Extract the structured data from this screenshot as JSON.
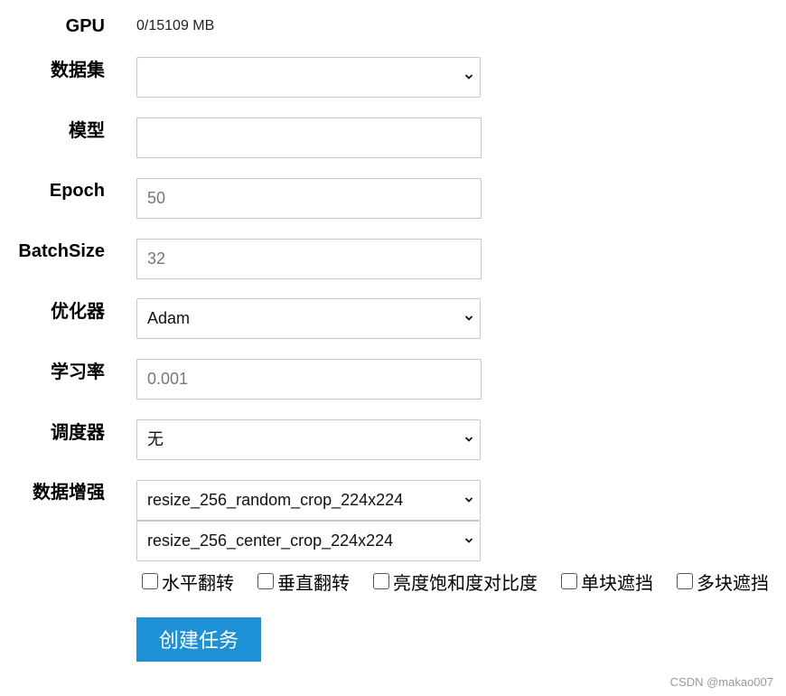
{
  "gpu": {
    "label": "GPU",
    "value": "0/15109 MB"
  },
  "dataset": {
    "label": "数据集",
    "value": ""
  },
  "model": {
    "label": "模型",
    "value": ""
  },
  "epoch": {
    "label": "Epoch",
    "value": "50"
  },
  "batch_size": {
    "label": "BatchSize",
    "value": "32"
  },
  "optimizer": {
    "label": "优化器",
    "value": "Adam"
  },
  "learning_rate": {
    "label": "学习率",
    "value": "0.001"
  },
  "scheduler": {
    "label": "调度器",
    "value": "无"
  },
  "augmentation": {
    "label": "数据增强",
    "train_transform": "resize_256_random_crop_224x224",
    "eval_transform": "resize_256_center_crop_224x224",
    "options": [
      {
        "label": "水平翻转",
        "checked": false
      },
      {
        "label": "垂直翻转",
        "checked": false
      },
      {
        "label": "亮度饱和度对比度",
        "checked": false
      },
      {
        "label": "单块遮挡",
        "checked": false
      },
      {
        "label": "多块遮挡",
        "checked": false
      }
    ]
  },
  "submit_label": "创建任务",
  "watermark": "CSDN @makao007"
}
